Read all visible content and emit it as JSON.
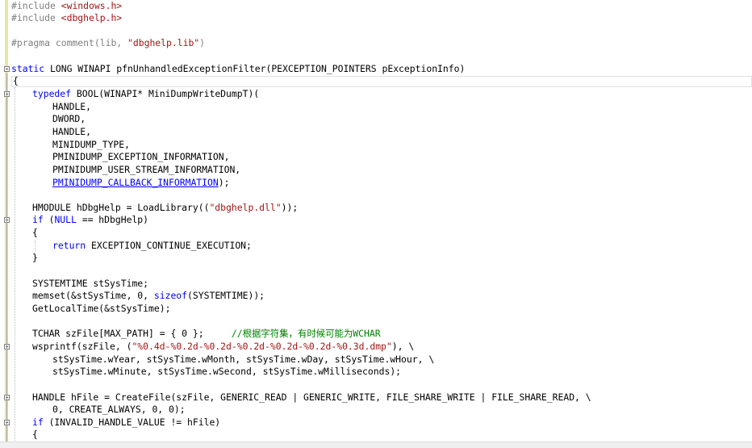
{
  "editor": {
    "lines": {
      "l1a": "#include ",
      "l1b": "<windows.h>",
      "l2a": "#include ",
      "l2b": "<dbghelp.h>",
      "l3a": "#pragma comment(lib, ",
      "l3b": "\"dbghelp.lib\"",
      "l3c": ")",
      "l4a": "static",
      "l4b": " LONG WINAPI pfnUnhandledExceptionFilter(PEXCEPTION_POINTERS pExceptionInfo)",
      "l5": "{",
      "l6a": "typedef",
      "l6b": " BOOL(WINAPI* MiniDumpWriteDumpT)(",
      "l7": "HANDLE,",
      "l8": "DWORD,",
      "l9": "HANDLE,",
      "l10": "MINIDUMP_TYPE,",
      "l11": "PMINIDUMP_EXCEPTION_INFORMATION,",
      "l12": "PMINIDUMP_USER_STREAM_INFORMATION,",
      "l13a": "PMINIDUMP_CALLBACK_INFORMATION",
      "l13b": ");",
      "l14a": "HMODULE hDbgHelp = LoadLibrary((",
      "l14b": "\"dbghelp.dll\"",
      "l14c": "));",
      "l15a": "if",
      "l15b": " (",
      "l15c": "NULL",
      "l15d": " == hDbgHelp)",
      "l16": "{",
      "l17a": "return",
      "l17b": " EXCEPTION_CONTINUE_EXECUTION;",
      "l18": "}",
      "l19": "SYSTEMTIME stSysTime;",
      "l20a": "memset(&stSysTime, 0, ",
      "l20b": "sizeof",
      "l20c": "(SYSTEMTIME));",
      "l21": "GetLocalTime(&stSysTime);",
      "l22a": "TCHAR szFile[MAX_PATH] = { 0 };     ",
      "l22b": "//根据字符集，有时候可能为WCHAR",
      "l23a": "wsprintf(szFile, (",
      "l23b": "\"%0.4d-%0.2d-%0.2d-%0.2d-%0.2d-%0.2d-%0.3d.dmp\"",
      "l23c": "), \\",
      "l24": "stSysTime.wYear, stSysTime.wMonth, stSysTime.wDay, stSysTime.wHour, \\",
      "l25": "stSysTime.wMinute, stSysTime.wSecond, stSysTime.wMilliseconds);",
      "l26": "HANDLE hFile = CreateFile(szFile, GENERIC_READ | GENERIC_WRITE, FILE_SHARE_WRITE | FILE_SHARE_READ, \\",
      "l27": "0, CREATE_ALWAYS, 0, 0);",
      "l28a": "if",
      "l28b": " (INVALID_HANDLE_VALUE != hFile)",
      "l29": "{"
    }
  },
  "colors": {
    "keyword": "#0000ff",
    "preprocessor": "#808080",
    "string": "#a31515",
    "comment": "#008000",
    "change_bar": "#e8e4a8"
  }
}
